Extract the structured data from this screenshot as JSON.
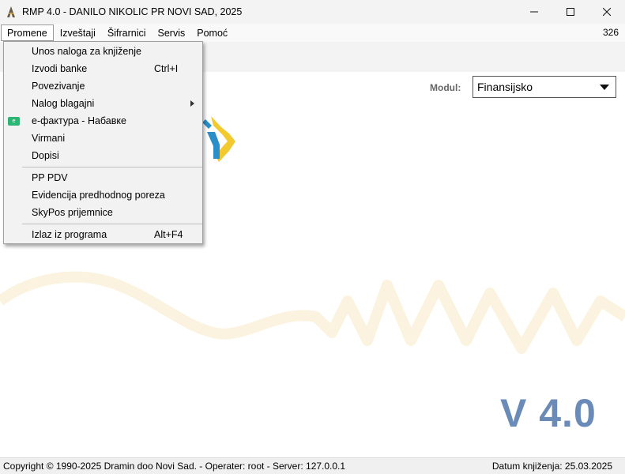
{
  "window": {
    "title": "RMP 4.0 - DANILO NIKOLIC PR NOVI SAD, 2025",
    "controls": [
      "minimize-icon",
      "maximize-icon",
      "close-icon"
    ]
  },
  "menubar": {
    "items": [
      {
        "label": "Promene",
        "active": true
      },
      {
        "label": "Izveštaji"
      },
      {
        "label": "Šifrarnici"
      },
      {
        "label": "Servis"
      },
      {
        "label": "Pomoć"
      }
    ],
    "count": "326"
  },
  "dropdown": {
    "items": [
      {
        "label": "Unos naloga za knjiženje"
      },
      {
        "label": "Izvodi banke",
        "shortcut": "Ctrl+I"
      },
      {
        "label": "Povezivanje"
      },
      {
        "label": "Nalog blagajni",
        "submenu": true
      },
      {
        "label": "е-фактура - Набавке",
        "icon": "e-invoice-icon"
      },
      {
        "label": "Virmani"
      },
      {
        "label": "Dopisi"
      },
      {
        "label": "PP PDV"
      },
      {
        "label": "Evidencija predhodnog poreza"
      },
      {
        "label": "SkyPos prijemnice"
      },
      {
        "label": "Izlaz iz programa",
        "shortcut": "Alt+F4"
      }
    ]
  },
  "main": {
    "modul_label": "Modul:",
    "modul_value": "Finansijsko",
    "version": "V 4.0"
  },
  "statusbar": {
    "left": "Copyright © 1990-2025 Dramin doo Novi Sad. - Operater: root - Server: 127.0.0.1",
    "right": "Datum knjiženja: 25.03.2025"
  },
  "colors": {
    "version_text": "#6a8ab8",
    "logo_yellow": "#f2c92e",
    "logo_blue": "#2a8fc8",
    "wave_beige": "#fbf3df",
    "eicon_green": "#2bb673"
  }
}
